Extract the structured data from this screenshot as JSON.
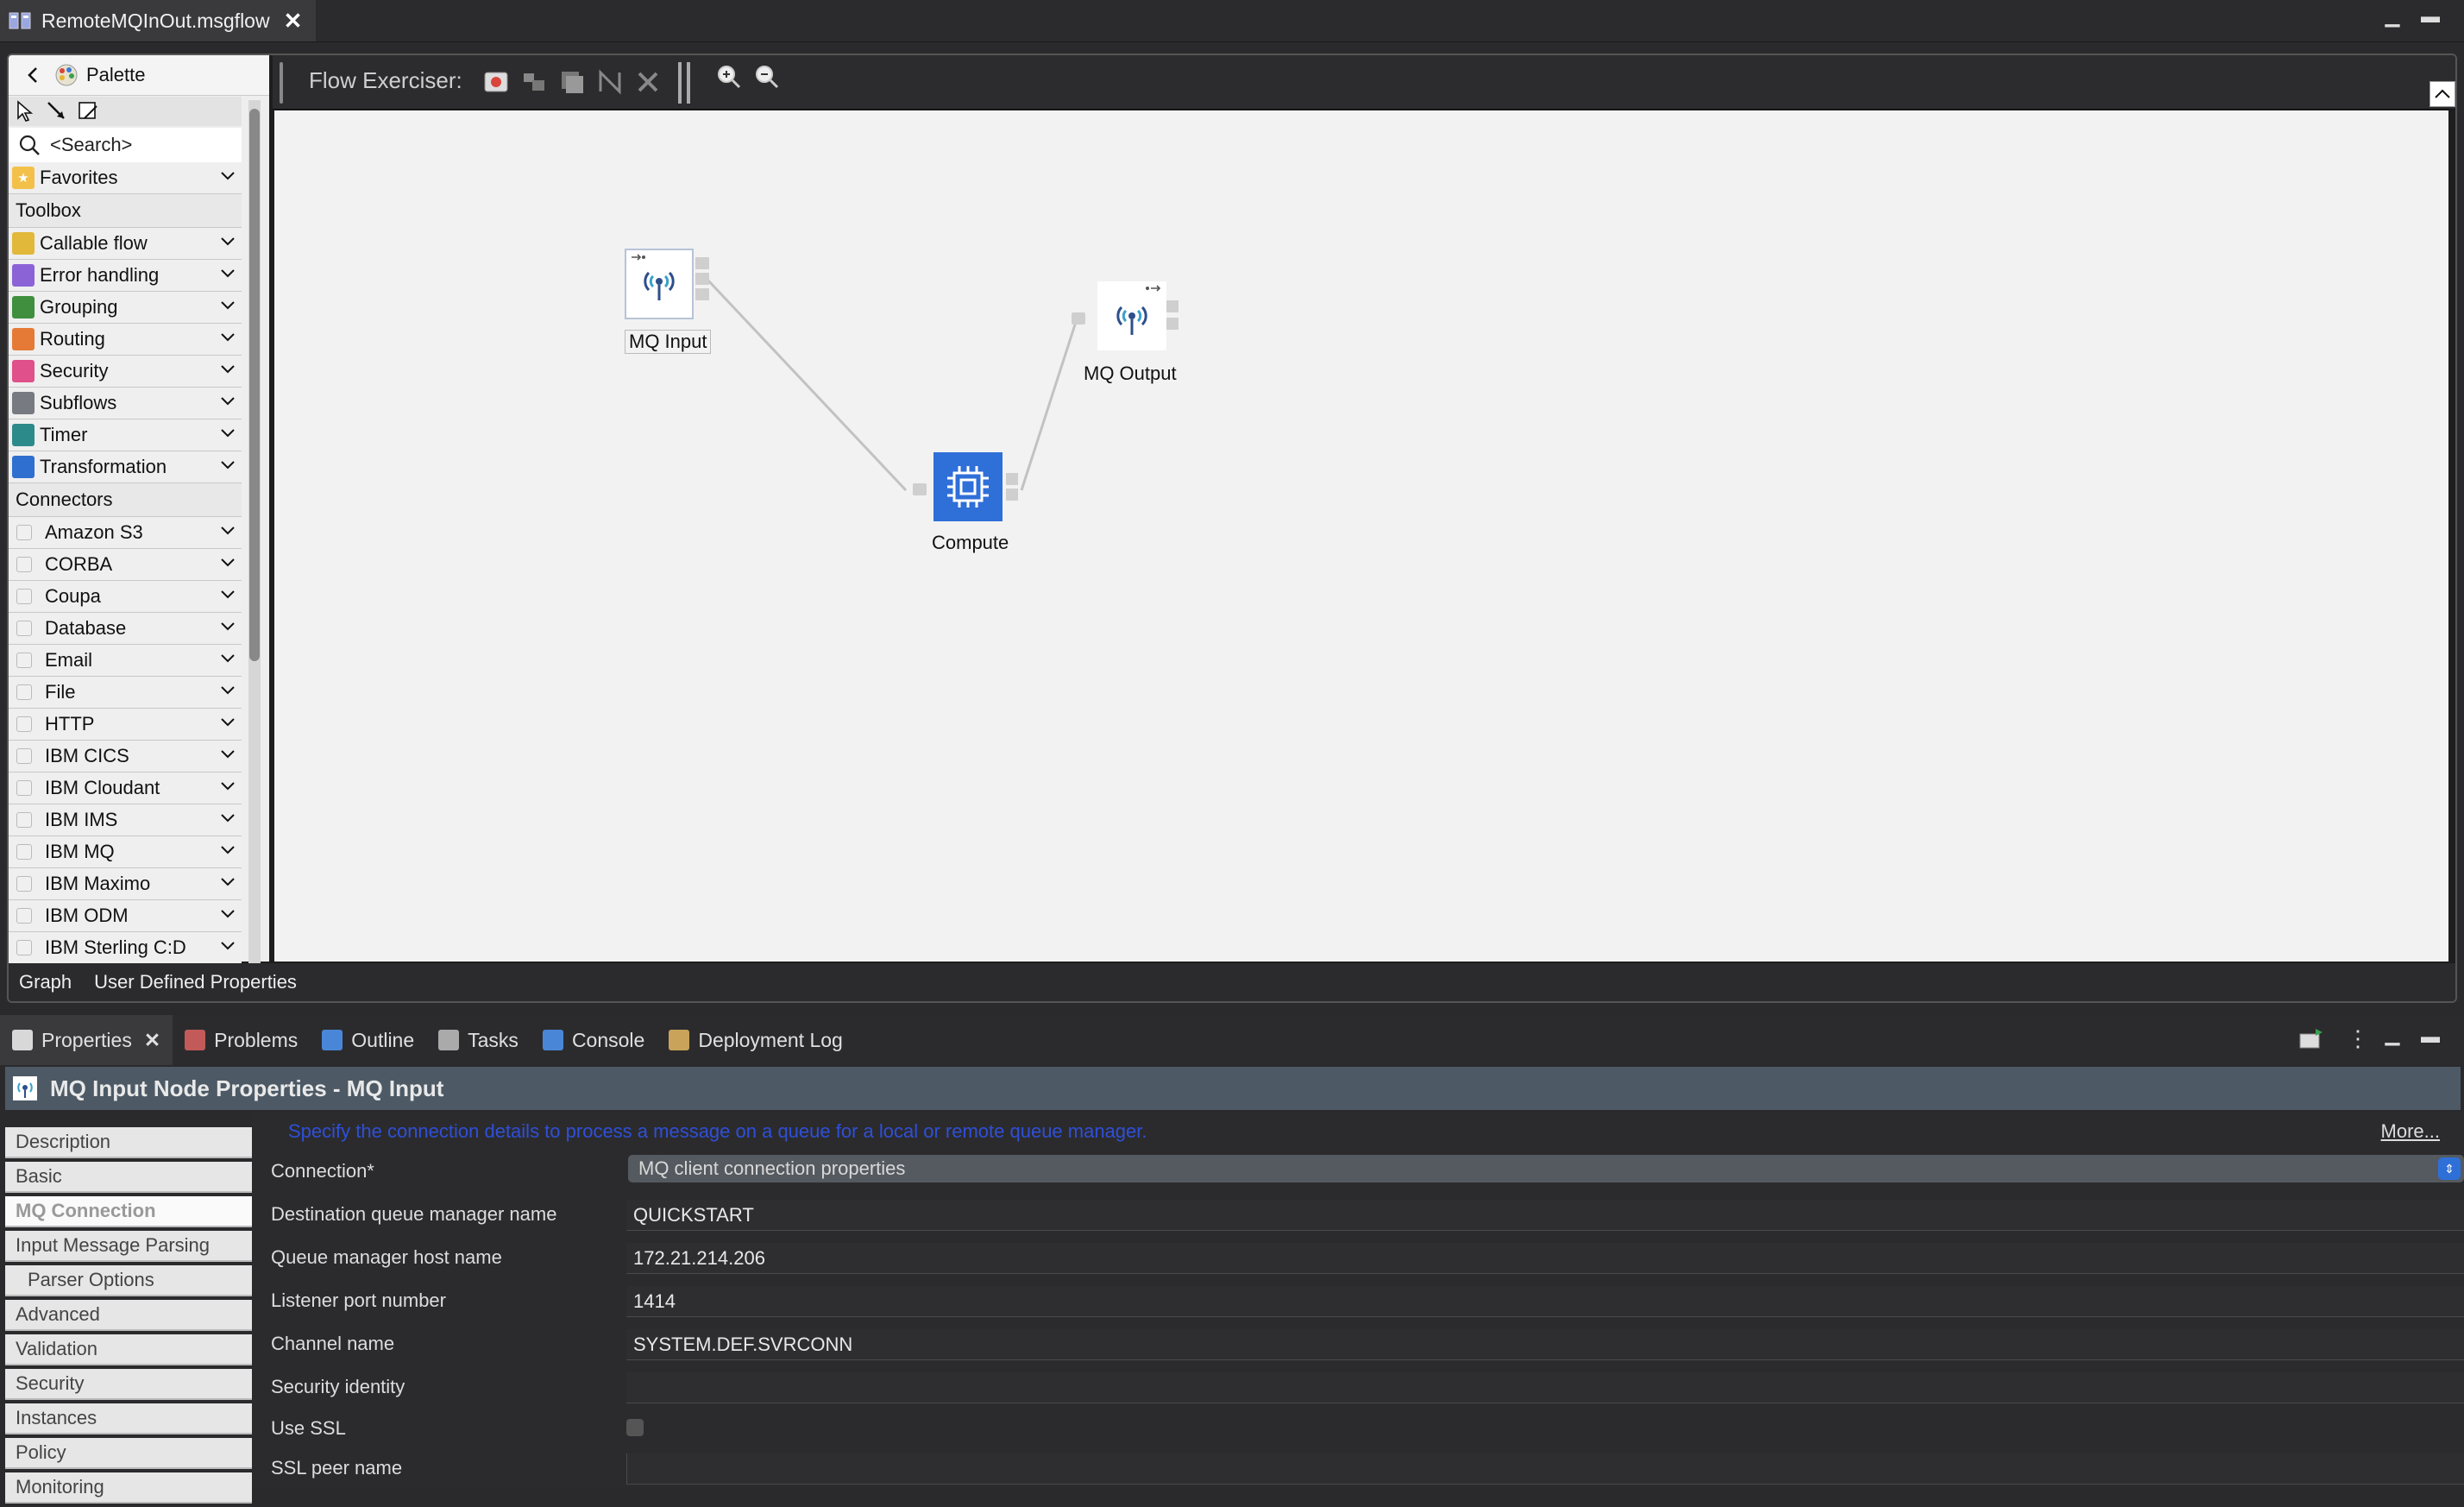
{
  "editor": {
    "tab_title": "RemoteMQInOut.msgflow",
    "close_glyph": "✕",
    "bottom_tabs": [
      "Graph",
      "User Defined Properties"
    ]
  },
  "palette": {
    "title": "Palette",
    "search_placeholder": "<Search>",
    "favorites": "Favorites",
    "toolbox_header": "Toolbox",
    "toolbox_items": [
      {
        "label": "Callable flow",
        "icon": "callable-flow-icon",
        "color": "#e1b83a"
      },
      {
        "label": "Error handling",
        "icon": "error-handling-icon",
        "color": "#8b63d6"
      },
      {
        "label": "Grouping",
        "icon": "grouping-icon",
        "color": "#3f8f3f"
      },
      {
        "label": "Routing",
        "icon": "routing-icon",
        "color": "#e57a36"
      },
      {
        "label": "Security",
        "icon": "security-icon",
        "color": "#e0508a"
      },
      {
        "label": "Subflows",
        "icon": "subflows-icon",
        "color": "#777a80"
      },
      {
        "label": "Timer",
        "icon": "timer-icon",
        "color": "#2d8a8a"
      },
      {
        "label": "Transformation",
        "icon": "transformation-icon",
        "color": "#2f6fd0"
      }
    ],
    "connectors_header": "Connectors",
    "connector_items": [
      {
        "label": "Amazon S3",
        "icon": "amazon-s3-icon",
        "color": "#f0f0f0"
      },
      {
        "label": "CORBA",
        "icon": "corba-icon",
        "color": "#f0f0f0"
      },
      {
        "label": "Coupa",
        "icon": "coupa-icon",
        "color": "#f0f0f0"
      },
      {
        "label": "Database",
        "icon": "database-icon",
        "color": "#f0f0f0"
      },
      {
        "label": "Email",
        "icon": "email-icon",
        "color": "#f0f0f0"
      },
      {
        "label": "File",
        "icon": "file-icon",
        "color": "#f0f0f0"
      },
      {
        "label": "HTTP",
        "icon": "http-icon",
        "color": "#f0f0f0"
      },
      {
        "label": "IBM CICS",
        "icon": "ibm-cics-icon",
        "color": "#f0f0f0"
      },
      {
        "label": "IBM Cloudant",
        "icon": "ibm-cloudant-icon",
        "color": "#f0f0f0"
      },
      {
        "label": "IBM IMS",
        "icon": "ibm-ims-icon",
        "color": "#f0f0f0"
      },
      {
        "label": "IBM MQ",
        "icon": "ibm-mq-icon",
        "color": "#f0f0f0"
      },
      {
        "label": "IBM Maximo",
        "icon": "ibm-maximo-icon",
        "color": "#f0f0f0"
      },
      {
        "label": "IBM ODM",
        "icon": "ibm-odm-icon",
        "color": "#f0f0f0"
      },
      {
        "label": "IBM Sterling C:D",
        "icon": "ibm-sterling-icon",
        "color": "#f0f0f0"
      }
    ]
  },
  "exerciser": {
    "label": "Flow Exerciser:"
  },
  "flow": {
    "nodes": [
      {
        "id": "mq-input",
        "label": "MQ Input"
      },
      {
        "id": "compute",
        "label": "Compute"
      },
      {
        "id": "mq-output",
        "label": "MQ Output"
      }
    ]
  },
  "views": {
    "tabs": [
      {
        "label": "Properties",
        "icon": "properties-icon",
        "active": true
      },
      {
        "label": "Problems",
        "icon": "problems-icon"
      },
      {
        "label": "Outline",
        "icon": "outline-icon"
      },
      {
        "label": "Tasks",
        "icon": "tasks-icon"
      },
      {
        "label": "Console",
        "icon": "console-icon"
      },
      {
        "label": "Deployment Log",
        "icon": "deployment-log-icon"
      }
    ],
    "close_glyph": "✕"
  },
  "properties": {
    "title": "MQ Input Node Properties - MQ Input",
    "description": "Specify the connection details to process a message on a queue for a local or remote queue manager.",
    "more_link": "More...",
    "sidebar": [
      {
        "label": "Description"
      },
      {
        "label": "Basic"
      },
      {
        "label": "MQ Connection",
        "active": true
      },
      {
        "label": "Input Message Parsing"
      },
      {
        "label": "Parser Options",
        "sub": true
      },
      {
        "label": "Advanced"
      },
      {
        "label": "Validation"
      },
      {
        "label": "Security"
      },
      {
        "label": "Instances"
      },
      {
        "label": "Policy"
      },
      {
        "label": "Monitoring"
      }
    ],
    "fields": {
      "connection_label": "Connection*",
      "connection_value": "MQ client connection properties",
      "dest_qm_label": "Destination queue manager name",
      "dest_qm_value": "QUICKSTART",
      "host_label": "Queue manager host name",
      "host_value": "172.21.214.206",
      "port_label": "Listener port number",
      "port_value": "1414",
      "channel_label": "Channel name",
      "channel_value": "SYSTEM.DEF.SVRCONN",
      "security_identity_label": "Security identity",
      "security_identity_value": "",
      "use_ssl_label": "Use SSL",
      "use_ssl_checked": false,
      "ssl_peer_label": "SSL peer name"
    }
  }
}
